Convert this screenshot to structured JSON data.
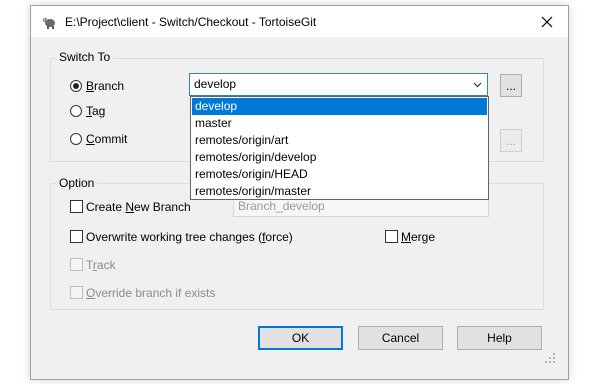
{
  "window": {
    "title": "E:\\Project\\client - Switch/Checkout - TortoiseGit"
  },
  "switch_to": {
    "group_label": "Switch To",
    "options": [
      {
        "label": "Branch",
        "accel": "B",
        "selected": true
      },
      {
        "label": "Tag",
        "accel": "T",
        "selected": false
      },
      {
        "label": "Commit",
        "accel": "C",
        "selected": false
      }
    ],
    "branch_combo_value": "develop",
    "browse_label": "...",
    "dropdown_items": [
      {
        "label": "develop",
        "selected": true
      },
      {
        "label": "master",
        "selected": false
      },
      {
        "label": "remotes/origin/art",
        "selected": false
      },
      {
        "label": "remotes/origin/develop",
        "selected": false
      },
      {
        "label": "remotes/origin/HEAD",
        "selected": false
      },
      {
        "label": "remotes/origin/master",
        "selected": false
      }
    ]
  },
  "option": {
    "group_label": "Option",
    "create_new_branch": {
      "pre": "Create ",
      "accel": "N",
      "post": "ew Branch",
      "checked": false
    },
    "new_branch_value": "Branch_develop",
    "overwrite": {
      "pre": "Overwrite working tree changes (",
      "accel": "f",
      "post": "orce)",
      "checked": false
    },
    "merge": {
      "pre": "",
      "accel": "M",
      "post": "erge",
      "checked": false
    },
    "track": {
      "pre": "T",
      "accel": "r",
      "post": "ack",
      "checked": false,
      "enabled": false
    },
    "override": {
      "pre": "",
      "accel": "O",
      "post": "verride branch if exists",
      "checked": false,
      "enabled": false
    }
  },
  "buttons": {
    "ok": "OK",
    "cancel": "Cancel",
    "help": "Help"
  },
  "colors": {
    "selection": "#0078d7",
    "combo_border": "#3c7fb1"
  },
  "icons": {
    "app": "tortoisegit-icon",
    "close": "close-icon",
    "combo": "chevron-down-icon",
    "grip": "resize-grip-icon"
  }
}
